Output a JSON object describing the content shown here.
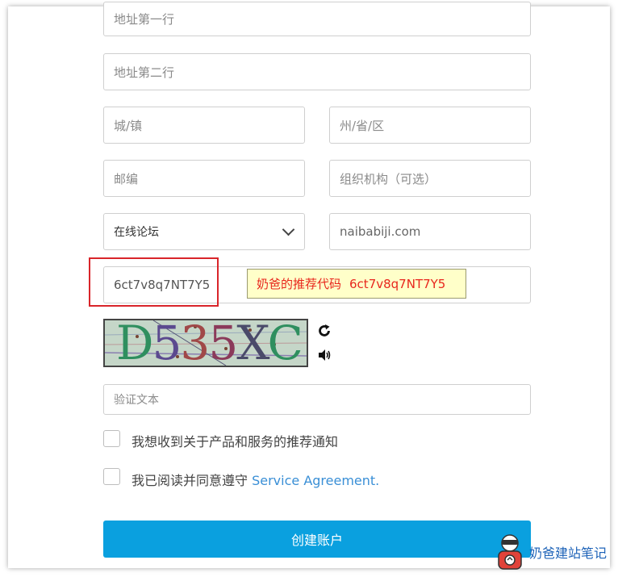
{
  "form": {
    "address_line1": {
      "placeholder": "地址第一行"
    },
    "address_line2": {
      "placeholder": "地址第二行"
    },
    "city": {
      "placeholder": "城/镇"
    },
    "state": {
      "placeholder": "州/省/区"
    },
    "postcode": {
      "placeholder": "邮编"
    },
    "organization": {
      "placeholder": "组织机构（可选）"
    },
    "referral_source": {
      "selected": "在线论坛"
    },
    "referral_site": {
      "value": "naibabiji.com"
    },
    "referral_code": {
      "value": "6ct7v8q7NT7Y5"
    },
    "captcha": {
      "text": "D535XC"
    },
    "verify_text": {
      "placeholder": "验证文本"
    },
    "newsletter": {
      "label": "我想收到关于产品和服务的推荐通知",
      "checked": false
    },
    "agreement": {
      "label_prefix": "我已阅读并同意遵守 ",
      "link_text": "Service Agreement.",
      "checked": false
    },
    "submit_label": "创建账户"
  },
  "tooltip": {
    "label": "奶爸的推荐代码",
    "code": "6ct7v8q7NT7Y5"
  },
  "watermark": {
    "text": "奶爸建站笔记"
  },
  "colors": {
    "accent": "#0aa0df",
    "highlight_border": "#d9252a",
    "tooltip_bg": "#ffffc9",
    "tooltip_text": "#e8261c",
    "link": "#3a8fd6"
  },
  "icons": {
    "refresh": "refresh-icon",
    "audio": "speaker-icon",
    "dropdown": "chevron-down-icon",
    "mascot": "mascot-icon"
  }
}
